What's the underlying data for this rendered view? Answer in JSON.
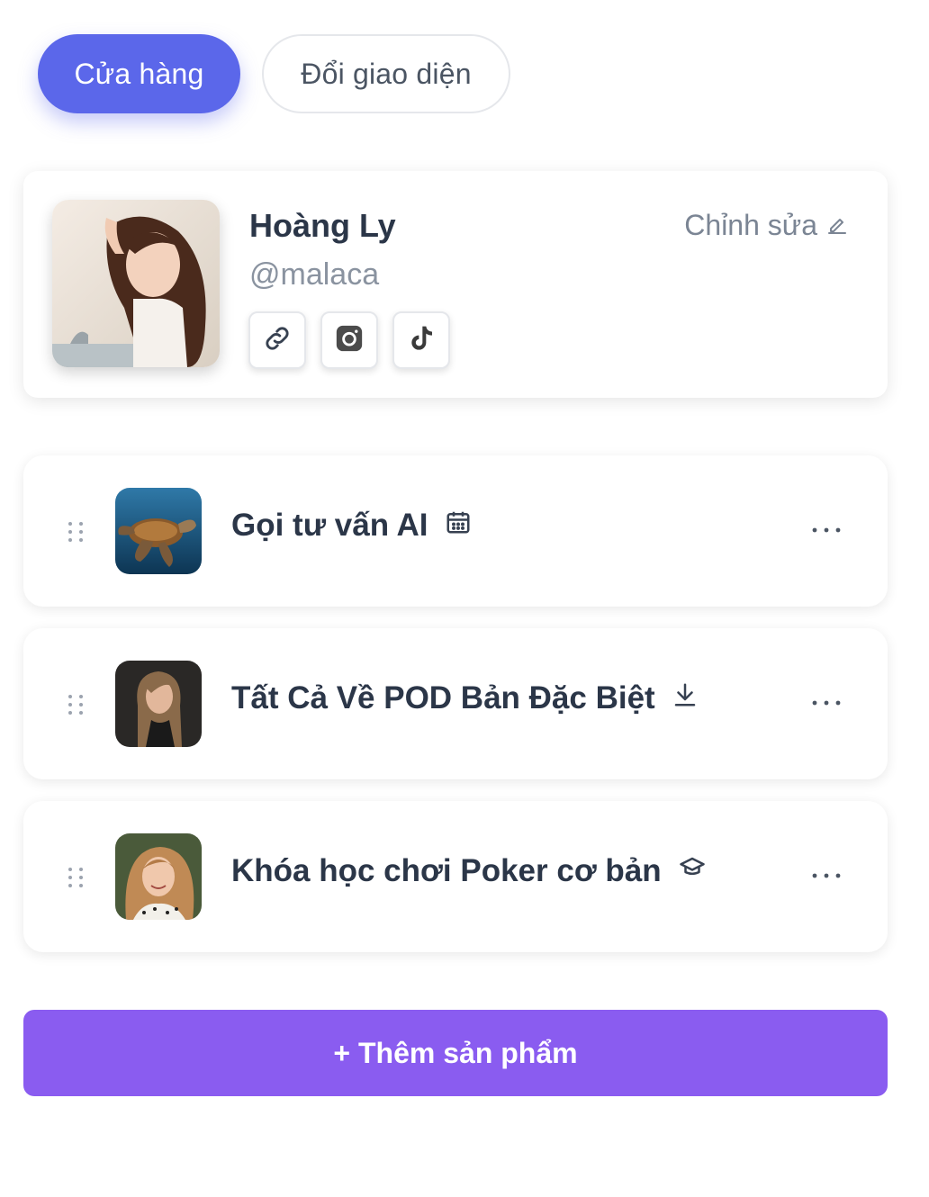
{
  "tabs": {
    "store": "Cửa hàng",
    "change_theme": "Đổi giao diện"
  },
  "profile": {
    "name": "Hoàng Ly",
    "handle": "@malaca",
    "edit_label": "Chỉnh sửa",
    "socials": [
      "link-icon",
      "instagram-icon",
      "tiktok-icon"
    ]
  },
  "products": [
    {
      "title": "Gọi tư vấn AI",
      "type_icon": "calendar-icon"
    },
    {
      "title": "Tất Cả Về POD Bản Đặc Biệt",
      "type_icon": "download-icon"
    },
    {
      "title": "Khóa học chơi Poker cơ bản",
      "type_icon": "graduation-cap-icon"
    }
  ],
  "add_button": "+ Thêm sản phẩm",
  "colors": {
    "primary": "#5b67ea",
    "add_button": "#8a5cf0",
    "text_dark": "#2b3648",
    "text_muted": "#8a93a0"
  }
}
